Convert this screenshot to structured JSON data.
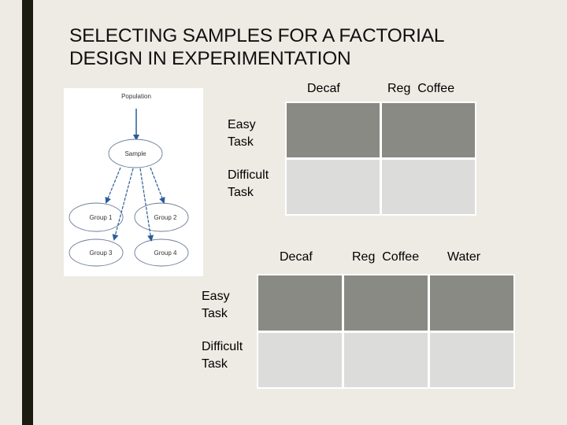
{
  "slide": {
    "title_lines": [
      "SELECTING SAMPLES FOR A FACTORIAL",
      "DESIGN IN EXPERIMENTATION"
    ],
    "colors": {
      "background": "#eeebe4",
      "accent_bar": "#1c1c10",
      "cell_dark": "#8a8a84",
      "cell_light": "#dcdcda",
      "arrow": "#2a5c9a"
    }
  },
  "diagram": {
    "top_label": "Population",
    "sample_label": "Sample",
    "groups": [
      "Group 1",
      "Group 2",
      "Group 3",
      "Group 4"
    ]
  },
  "table_2x2": {
    "columns": [
      "Decaf",
      "Reg  Coffee"
    ],
    "rows": [
      {
        "label_lines": [
          "Easy",
          "Task"
        ],
        "shade": "dark"
      },
      {
        "label_lines": [
          "Difficult",
          "Task"
        ],
        "shade": "light"
      }
    ]
  },
  "table_2x3": {
    "columns": [
      "Decaf",
      "Reg  Coffee",
      "Water"
    ],
    "rows": [
      {
        "label_lines": [
          "Easy",
          "Task"
        ],
        "shade": "dark"
      },
      {
        "label_lines": [
          "Difficult",
          "Task"
        ],
        "shade": "light"
      }
    ]
  }
}
